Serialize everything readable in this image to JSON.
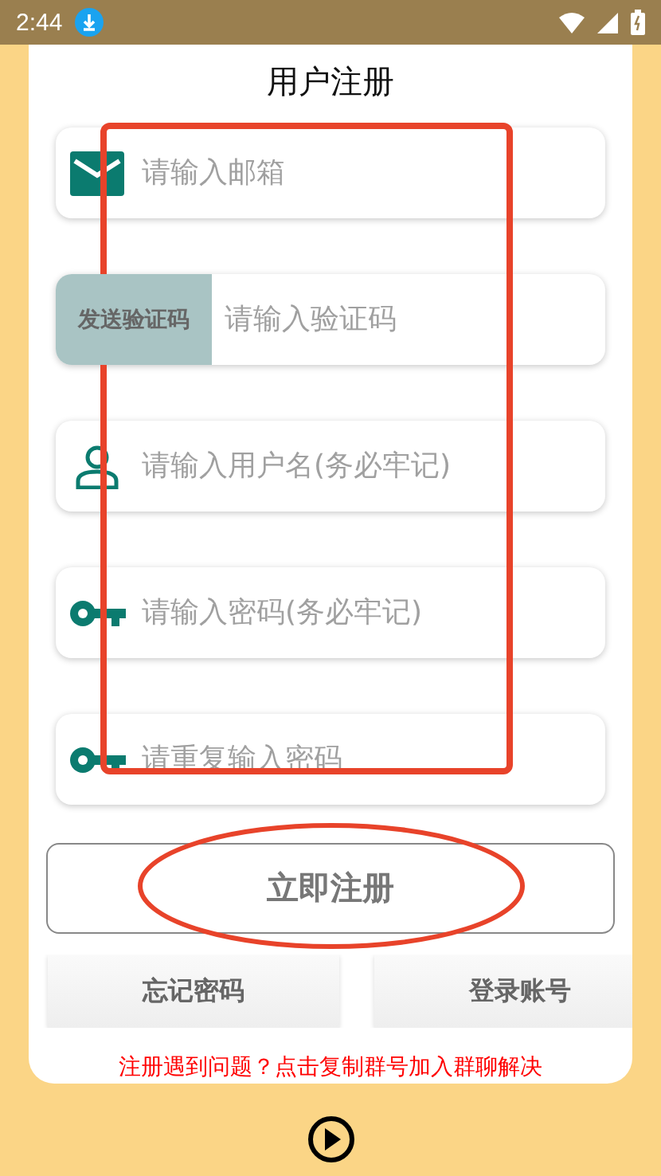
{
  "status_bar": {
    "time": "2:44"
  },
  "dialog": {
    "title": "用户注册",
    "fields": [
      {
        "kind": "email",
        "placeholder": "请输入邮箱"
      },
      {
        "kind": "code",
        "button": "发送验证码",
        "placeholder": "请输入验证码"
      },
      {
        "kind": "user",
        "placeholder": "请输入用户名(务必牢记)"
      },
      {
        "kind": "key",
        "placeholder": "请输入密码(务必牢记)"
      },
      {
        "kind": "key",
        "placeholder": "请重复输入密码"
      }
    ],
    "register_button": "立即注册",
    "links": [
      "忘记密码",
      "登录账号"
    ],
    "help_text": "注册遇到问题？点击复制群号加入群聊解决"
  },
  "annotations": [
    {
      "kind": "rectangle"
    },
    {
      "kind": "ellipse"
    }
  ]
}
